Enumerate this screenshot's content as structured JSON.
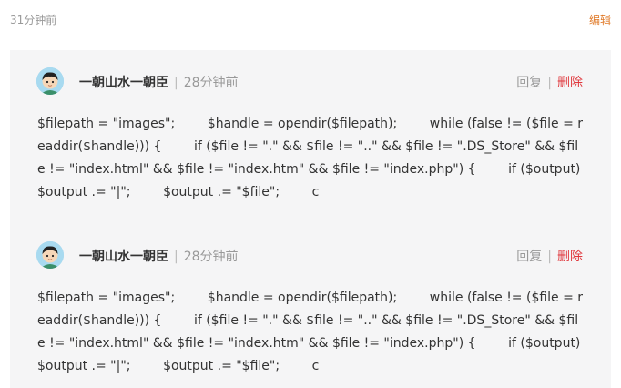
{
  "top": {
    "time": "31分钟前",
    "edit_label": "编辑"
  },
  "replies": [
    {
      "author": "一朝山水一朝臣",
      "separator": "|",
      "time": "28分钟前",
      "reply_label": "回复",
      "action_separator": "|",
      "delete_label": "删除",
      "content": "$filepath = \"images\";        $handle = opendir($filepath);        while (false != ($file = readdir($handle))) {        if ($file != \".\" && $file != \"..\" && $file != \".DS_Store\" && $file != \"index.html\" && $file != \"index.htm\" && $file != \"index.php\") {        if ($output) $output .= \"|\";        $output .= \"$file\";        c"
    },
    {
      "author": "一朝山水一朝臣",
      "separator": "|",
      "time": "28分钟前",
      "reply_label": "回复",
      "action_separator": "|",
      "delete_label": "删除",
      "content": "$filepath = \"images\";        $handle = opendir($filepath);        while (false != ($file = readdir($handle))) {        if ($file != \".\" && $file != \"..\" && $file != \".DS_Store\" && $file != \"index.html\" && $file != \"index.htm\" && $file != \"index.php\") {        if ($output) $output .= \"|\";        $output .= \"$file\";        c"
    }
  ],
  "colors": {
    "edit": "#e07b2a",
    "delete": "#e0393e",
    "panel_bg": "#f5f5f6",
    "muted": "#999999"
  }
}
